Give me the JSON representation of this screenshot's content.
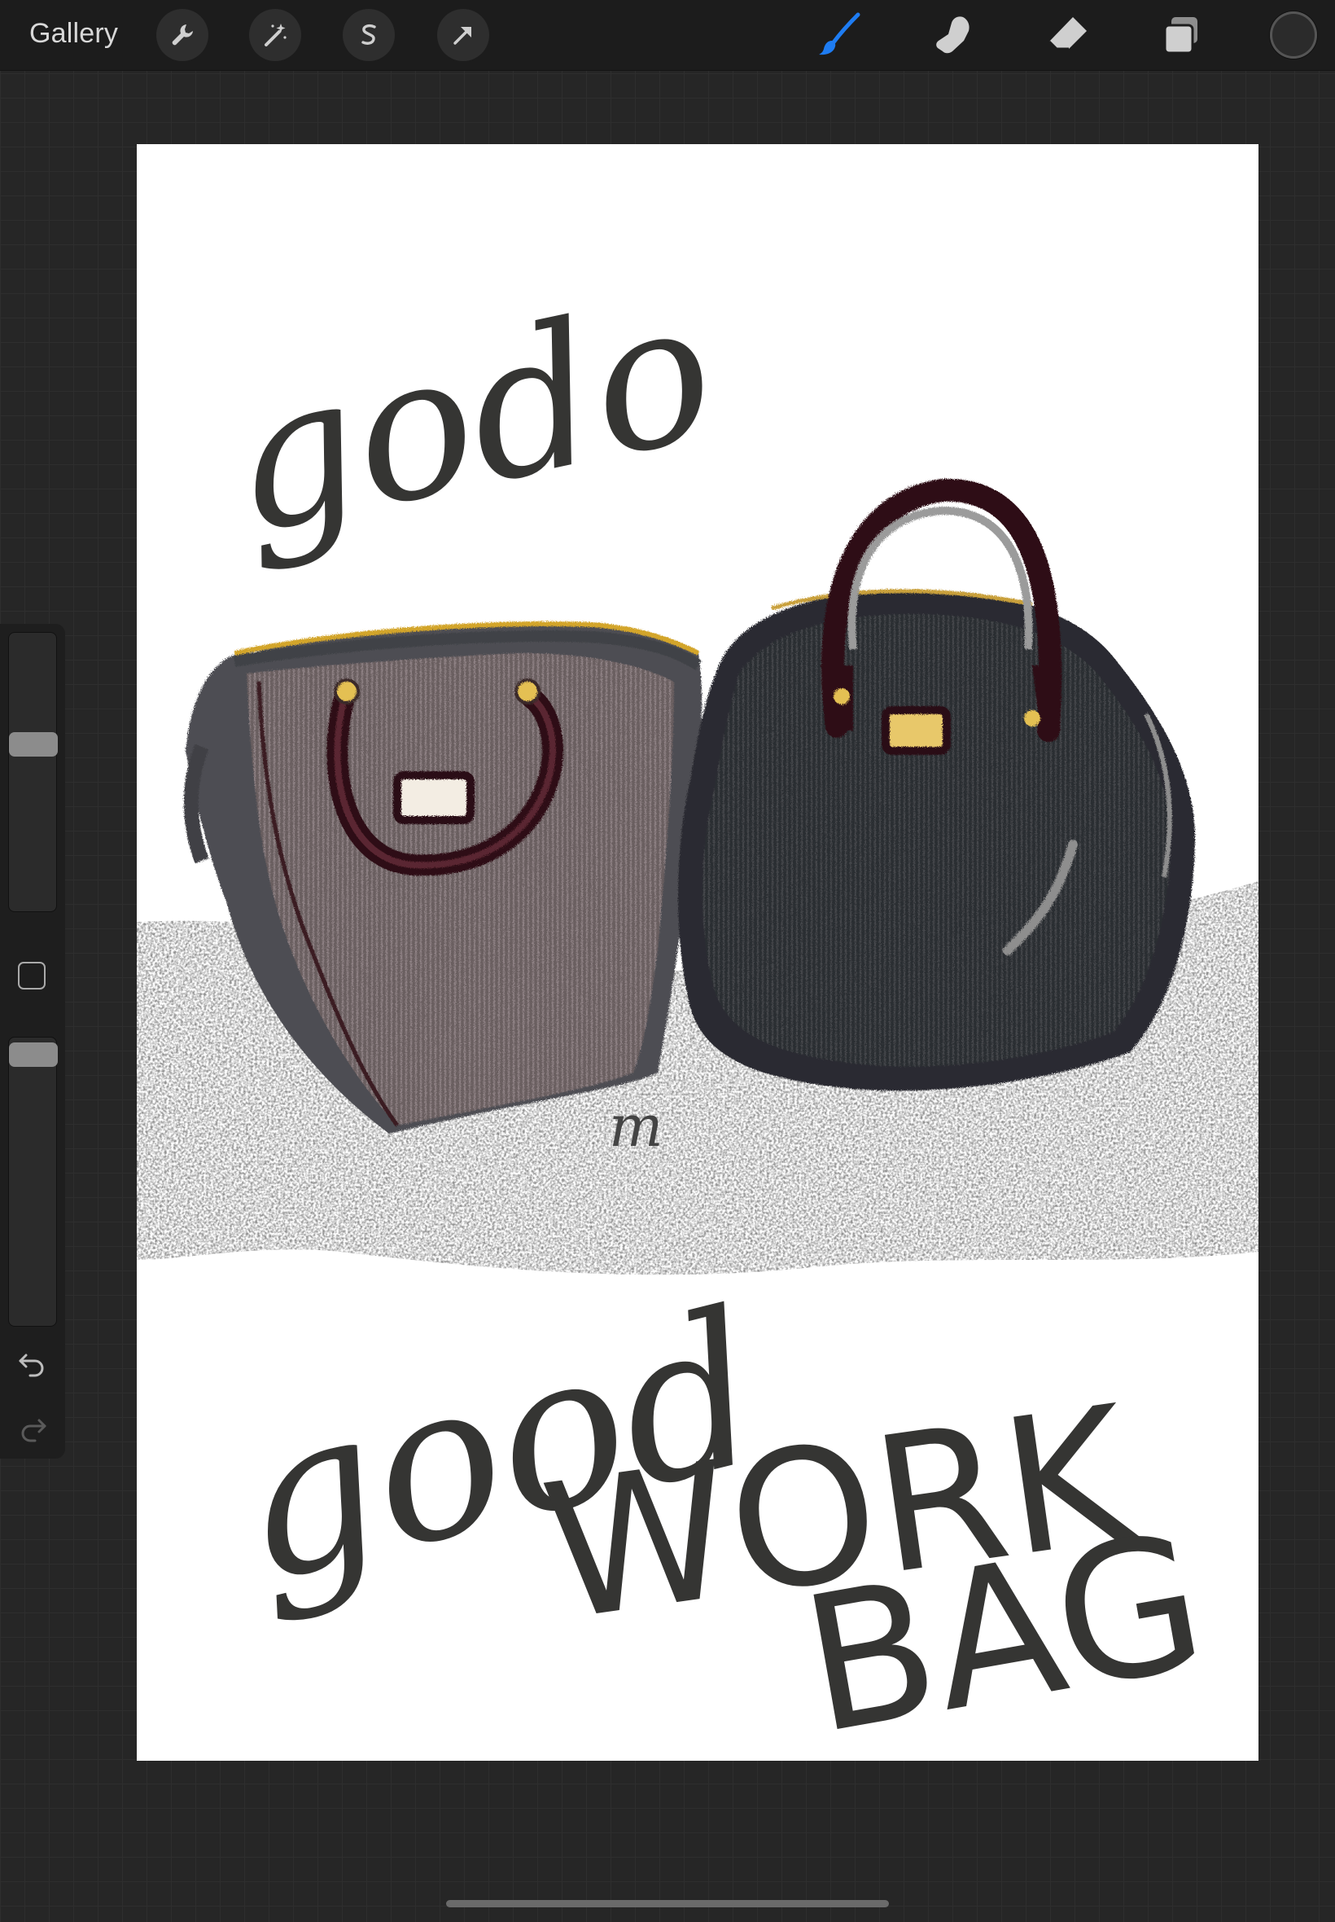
{
  "toolbar": {
    "gallery_label": "Gallery",
    "left_tools": [
      {
        "name": "actions",
        "icon": "wrench-icon"
      },
      {
        "name": "adjustments",
        "icon": "magic-wand-icon"
      },
      {
        "name": "selection",
        "icon": "selection-s-icon"
      },
      {
        "name": "transform",
        "icon": "arrow-cursor-icon"
      }
    ],
    "right_tools": [
      {
        "name": "brush",
        "icon": "brush-icon",
        "active": true
      },
      {
        "name": "smudge",
        "icon": "smudge-finger-icon",
        "active": false
      },
      {
        "name": "eraser",
        "icon": "eraser-icon",
        "active": false
      },
      {
        "name": "layers",
        "icon": "layers-icon",
        "active": false
      }
    ],
    "active_color": "#2b2b2b",
    "accent_color": "#1e7cf2"
  },
  "sidebar": {
    "brush_size_level": 0.61,
    "opacity_level": 0.02,
    "modify_icon": "square-icon",
    "undo_icon": "undo-arrow-icon",
    "redo_icon": "redo-arrow-icon"
  },
  "artwork": {
    "text_top": "godo",
    "text_bottom_line1": "good",
    "text_bottom_line2": "WORK",
    "text_bottom_line3": "BAG",
    "signature": "m"
  }
}
